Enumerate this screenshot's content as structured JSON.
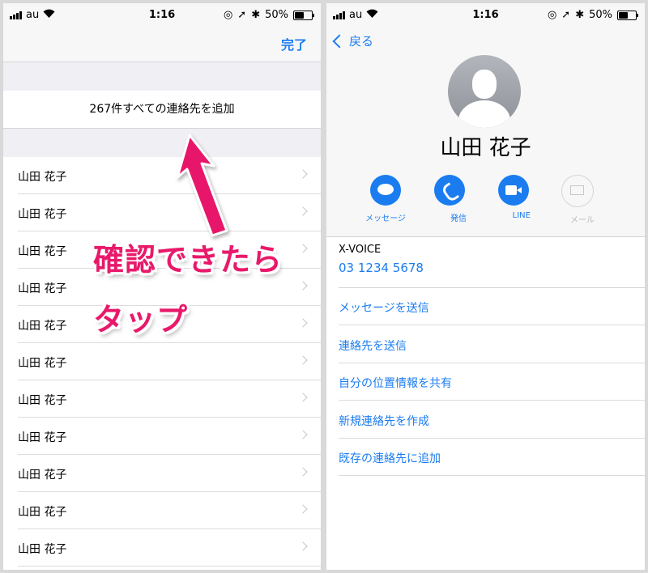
{
  "left_screen": {
    "status_bar": {
      "carrier": "au",
      "time": "1:16",
      "battery": "50%",
      "battery_level": 0.5
    },
    "nav": {
      "done_label": "完了"
    },
    "add_all_label": "267件すべての連絡先を追加",
    "contacts": [
      "山田 花子",
      "山田 花子",
      "山田 花子",
      "山田 花子",
      "山田 花子",
      "山田 花子",
      "山田 花子",
      "山田 花子",
      "山田 花子",
      "山田 花子",
      "山田 花子"
    ],
    "annotation": {
      "line1": "確認できたら",
      "line2": "タップ",
      "color": "#e8196a"
    }
  },
  "right_screen": {
    "status_bar": {
      "carrier": "au",
      "time": "1:16",
      "battery": "50%",
      "battery_level": 0.5
    },
    "back_label": "戻る",
    "contact_name": "山田 花子",
    "actions": [
      {
        "icon": "message-icon",
        "label": "メッセージ",
        "enabled": true
      },
      {
        "icon": "phone-icon",
        "label": "発信",
        "enabled": true
      },
      {
        "icon": "video-icon",
        "label": "LINE",
        "enabled": true
      },
      {
        "icon": "mail-icon",
        "label": "メール",
        "enabled": false
      }
    ],
    "phone": {
      "label": "X-VOICE",
      "number": "03 1234 5678"
    },
    "options": [
      "メッセージを送信",
      "連絡先を送信",
      "自分の位置情報を共有",
      "新規連絡先を作成",
      "既存の連絡先に追加"
    ]
  },
  "colors": {
    "ios_blue": "#1b7cf0",
    "annotation_pink": "#e8196a"
  }
}
